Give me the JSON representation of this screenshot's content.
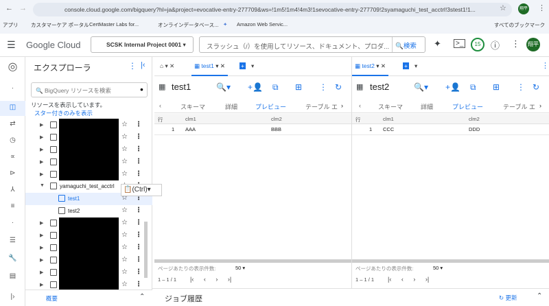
{
  "browser": {
    "url": "console.cloud.google.com/bigquery?hl=ja&project=evocative-entry-277709&ws=!1m5!1m4!4m3!1sevocative-entry-277709!2syamaguchi_test_acctrl!3stest1!1...",
    "profile": "翔平",
    "bookmarks": [
      "アプリ",
      "カスタマーケア ポータル",
      "CertMaster Labs for...",
      "オンラインデータベース...",
      "Amazon Web Servic..."
    ],
    "all_bookmarks": "すべてのブックマーク"
  },
  "header": {
    "logo": "Google Cloud",
    "project": "SCSK Internal Project 0001",
    "search_placeholder": "スラッシュ（/）を使用してリソース、ドキュメント、プロダ...",
    "search_button": "検索",
    "notifications": "15",
    "avatar": "翔平"
  },
  "explorer": {
    "title": "エクスプローラ",
    "search_placeholder": "BigQuery リソースを検索",
    "info": "リソースを表示しています。",
    "starred_link": "スター付きのみを表示",
    "dataset": "yamaguchi_test_acctrl",
    "tables": [
      "test1",
      "test2"
    ],
    "summary": "概要"
  },
  "paste_popup": "(Ctrl)",
  "panes": [
    {
      "tab": "test1",
      "title": "test1",
      "subtabs": [
        "スキーマ",
        "詳細",
        "プレビュー",
        "テーブル エ"
      ],
      "active_subtab": "プレビュー",
      "columns": [
        "行",
        "clm1",
        "clm2"
      ],
      "rows": [
        [
          "1",
          "AAA",
          "BBB"
        ]
      ],
      "per_page_label": "ページあたりの表示件数:",
      "per_page": "50",
      "range": "1 – 1 / 1"
    },
    {
      "tab": "test2",
      "title": "test2",
      "subtabs": [
        "スキーマ",
        "詳細",
        "プレビュー",
        "テーブル エ"
      ],
      "active_subtab": "プレビュー",
      "columns": [
        "行",
        "clm1",
        "clm2"
      ],
      "rows": [
        [
          "1",
          "CCC",
          "DDD"
        ]
      ],
      "per_page_label": "ページあたりの表示件数:",
      "per_page": "50",
      "range": "1 – 1 / 1"
    }
  ],
  "footer": {
    "title": "ジョブ履歴",
    "refresh": "更新"
  },
  "colors": {
    "accent": "#1a73e8",
    "avatar": "#1e6b26"
  }
}
